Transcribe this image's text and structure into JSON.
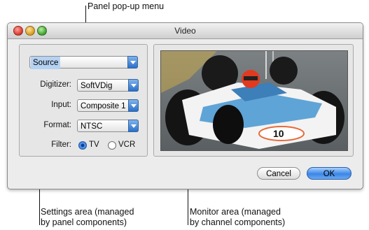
{
  "callouts": {
    "panel_popup_menu": "Panel pop-up menu",
    "settings_area": "Settings area (managed\nby panel components)",
    "monitor_area": "Monitor area (managed\nby channel components)"
  },
  "window": {
    "title": "Video"
  },
  "settings": {
    "panel_menu": "Source",
    "digitizer": {
      "label": "Digitizer:",
      "value": "SoftVDig"
    },
    "input": {
      "label": "Input:",
      "value": "Composite 1"
    },
    "format": {
      "label": "Format:",
      "value": "NTSC"
    },
    "filter": {
      "label": "Filter:",
      "options": [
        "TV",
        "VCR"
      ],
      "selected": "TV"
    }
  },
  "buttons": {
    "cancel": "Cancel",
    "ok": "OK"
  },
  "colors": {
    "accent": "#3b86e6",
    "window_bg": "#ececec"
  }
}
